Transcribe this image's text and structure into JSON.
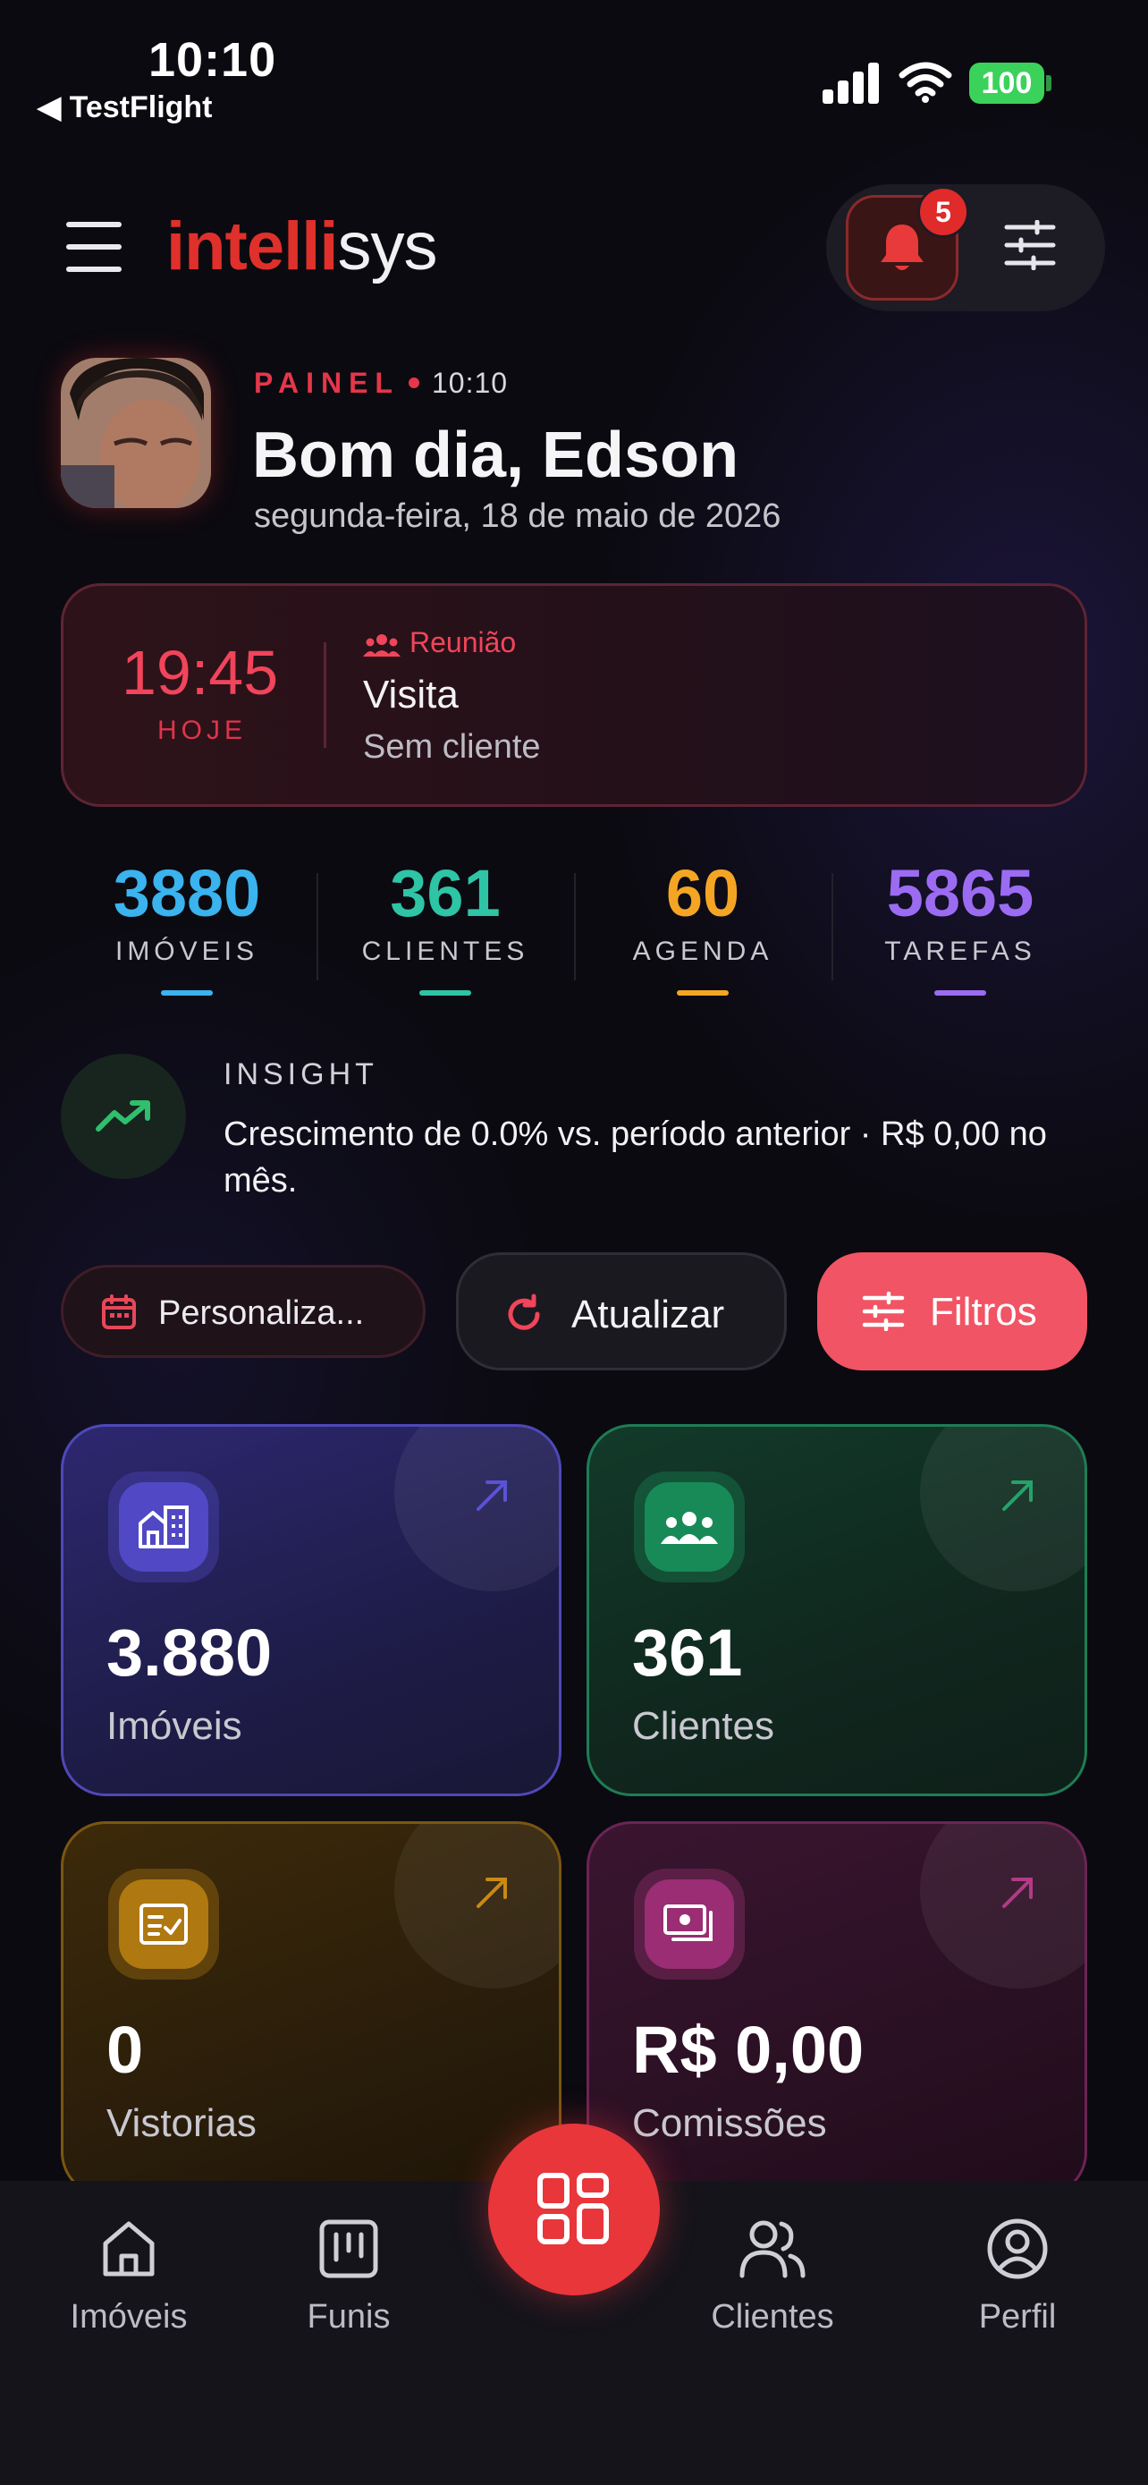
{
  "status_bar": {
    "time": "10:10",
    "back_label": "◀ TestFlight",
    "battery": "100"
  },
  "header": {
    "logo_red": "intelli",
    "logo_white": "sys",
    "notification_count": "5"
  },
  "greeting": {
    "eyebrow": "PAINEL",
    "time": "10:10",
    "title": "Bom dia, Edson",
    "date": "segunda-feira, 18 de maio de 2026"
  },
  "next_event": {
    "time": "19:45",
    "day": "HOJE",
    "type": "Reunião",
    "title": "Visita",
    "subtitle": "Sem cliente"
  },
  "stats": [
    {
      "value": "3880",
      "label": "IMÓVEIS",
      "color": "#3ab3ee"
    },
    {
      "value": "361",
      "label": "CLIENTES",
      "color": "#2ec4a6"
    },
    {
      "value": "60",
      "label": "AGENDA",
      "color": "#f5a524"
    },
    {
      "value": "5865",
      "label": "TAREFAS",
      "color": "#9b6cf2"
    }
  ],
  "insight": {
    "label": "INSIGHT",
    "text": "Crescimento de 0.0% vs. período anterior · R$ 0,00 no mês."
  },
  "actions": {
    "custom_label": "Personaliza...",
    "refresh_label": "Atualizar",
    "filter_label": "Filtros"
  },
  "tiles": [
    {
      "value": "3.880",
      "label": "Imóveis",
      "accent": "#5a52d6"
    },
    {
      "value": "361",
      "label": "Clientes",
      "accent": "#1f9a64"
    },
    {
      "value": "0",
      "label": "Vistorias",
      "accent": "#c98a14"
    },
    {
      "value": "R$ 0,00",
      "label": "Comissões",
      "accent": "#b23a86"
    }
  ],
  "bottom_nav": {
    "imoveis": "Imóveis",
    "funis": "Funis",
    "clientes": "Clientes",
    "perfil": "Perfil"
  }
}
